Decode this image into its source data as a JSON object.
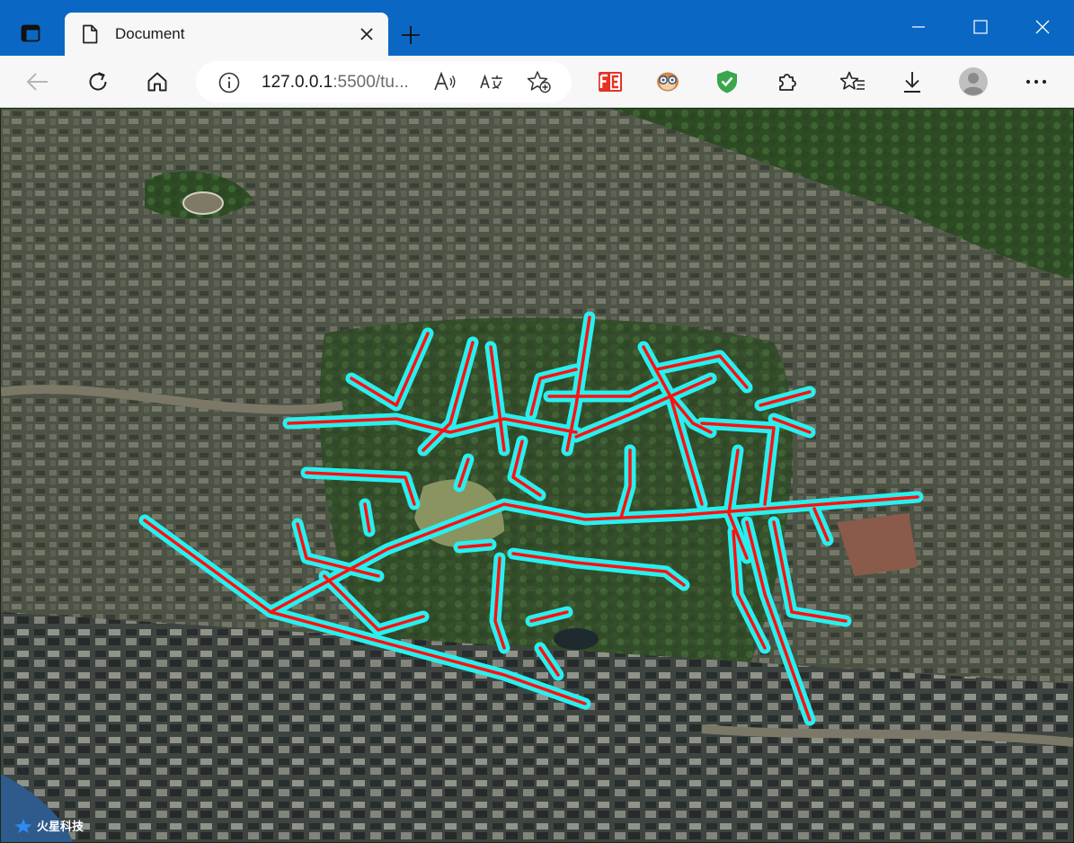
{
  "browser": {
    "tab_title": "Document",
    "url_host": "127.0.0.1",
    "url_rest": ":5500/tu...",
    "colors": {
      "titlebar": "#0a68c4",
      "toolbar": "#f7f7f7"
    },
    "icons": [
      "tab-actions-icon",
      "page-icon",
      "close-icon",
      "plus-icon",
      "minimize-icon",
      "maximize-icon",
      "window-close-icon",
      "back-arrow-icon",
      "refresh-icon",
      "home-icon",
      "info-icon",
      "read-aloud-icon",
      "translate-icon",
      "add-favorite-icon",
      "fe-extension-icon",
      "owl-extension-icon",
      "shield-extension-icon",
      "extensions-icon",
      "favorites-icon",
      "download-icon",
      "profile-icon",
      "more-icon"
    ]
  },
  "map": {
    "logo_text": "火星科技",
    "route_colors": {
      "outline": "#28f0f0",
      "core": "#ff1010"
    }
  }
}
